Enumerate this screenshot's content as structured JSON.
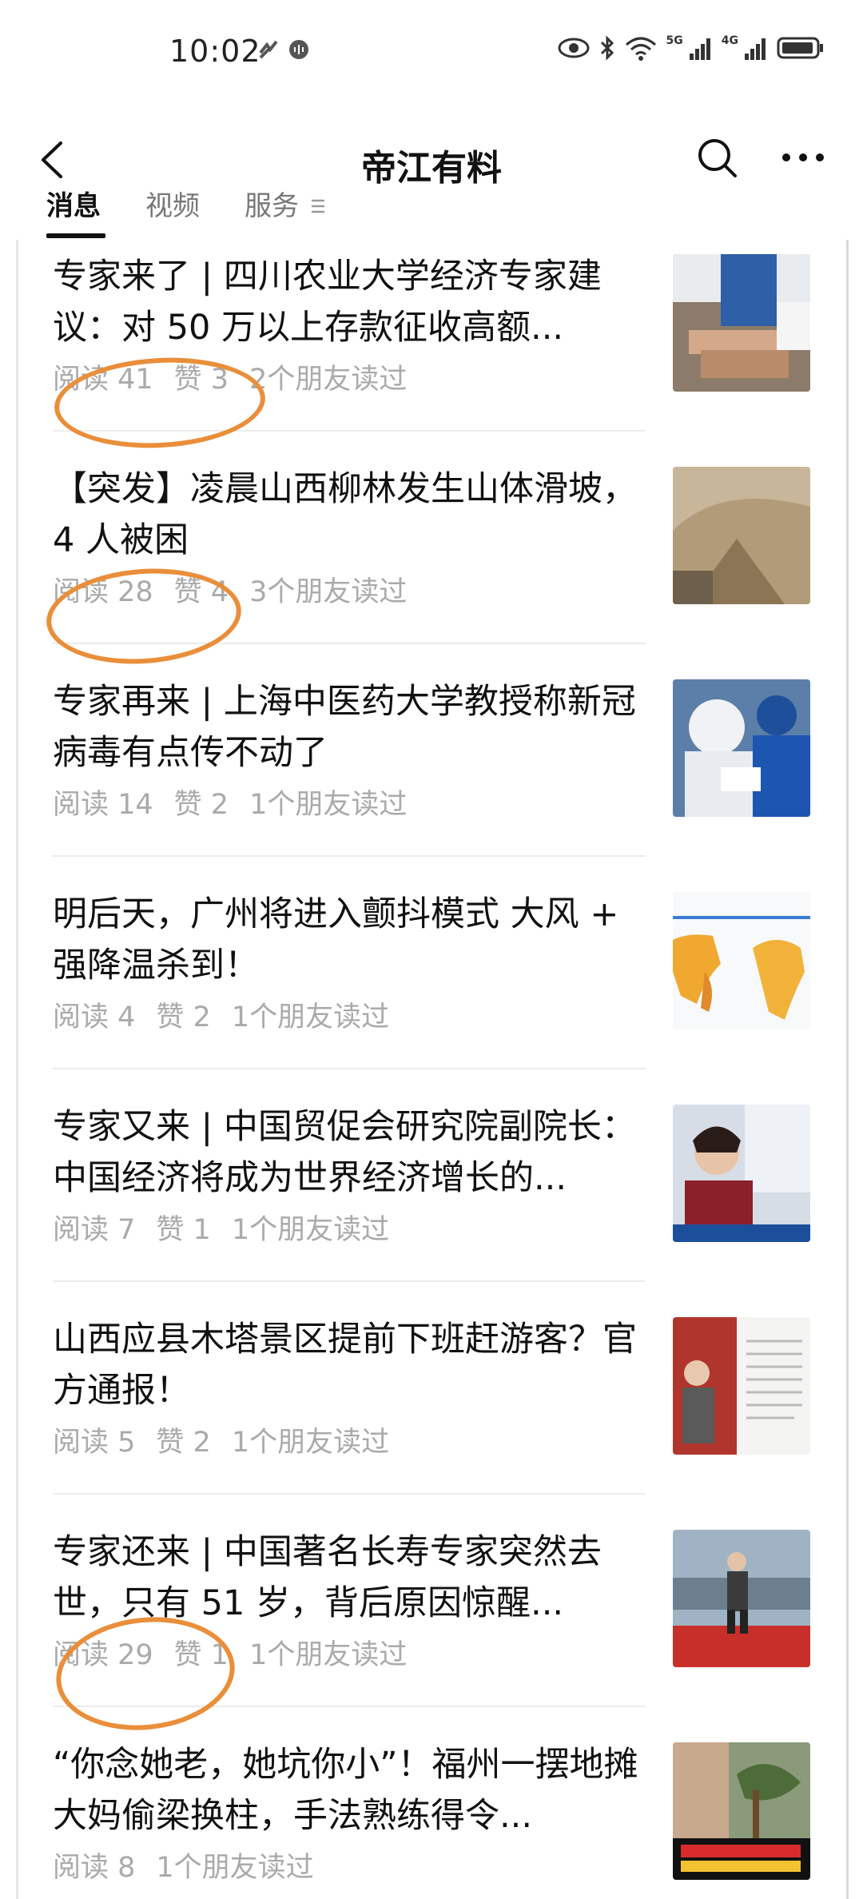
{
  "status_bar": {
    "time": "10:02"
  },
  "header": {
    "title": "帝江有料"
  },
  "tabs": [
    {
      "label": "消息"
    },
    {
      "label": "视频"
    },
    {
      "label": "服务"
    }
  ],
  "articles": [
    {
      "title": "专家来了 | 四川农业大学经济专家建议：对 50 万以上存款征收高额...",
      "reads": "阅读 41",
      "likes": "赞 3",
      "friends": "2个朋友读过"
    },
    {
      "title": "【突发】凌晨山西柳林发生山体滑坡，4 人被困",
      "reads": "阅读 28",
      "likes": "赞 4",
      "friends": "3个朋友读过"
    },
    {
      "title": "专家再来 | 上海中医药大学教授称新冠病毒有点传不动了",
      "reads": "阅读 14",
      "likes": "赞 2",
      "friends": "1个朋友读过"
    },
    {
      "title": "明后天，广州将进入颤抖模式 大风 + 强降温杀到！",
      "reads": "阅读 4",
      "likes": "赞 2",
      "friends": "1个朋友读过"
    },
    {
      "title": "专家又来 | 中国贸促会研究院副院长：中国经济将成为世界经济增长的...",
      "reads": "阅读 7",
      "likes": "赞 1",
      "friends": "1个朋友读过"
    },
    {
      "title": "山西应县木塔景区提前下班赶游客？官方通报！",
      "reads": "阅读 5",
      "likes": "赞 2",
      "friends": "1个朋友读过"
    },
    {
      "title": "专家还来 | 中国著名长寿专家突然去世，只有 51 岁，背后原因惊醒...",
      "reads": "阅读 29",
      "likes": "赞 1",
      "friends": "1个朋友读过"
    },
    {
      "title": "“你念她老，她坑你小”！福州一摆地摊大妈偷梁换柱，手法熟练得令...",
      "reads": "阅读 8",
      "likes": "",
      "friends": "1个朋友读过"
    }
  ],
  "colors": {
    "highlight": "#ea8e3a",
    "meta_text": "#aaaaaa"
  }
}
